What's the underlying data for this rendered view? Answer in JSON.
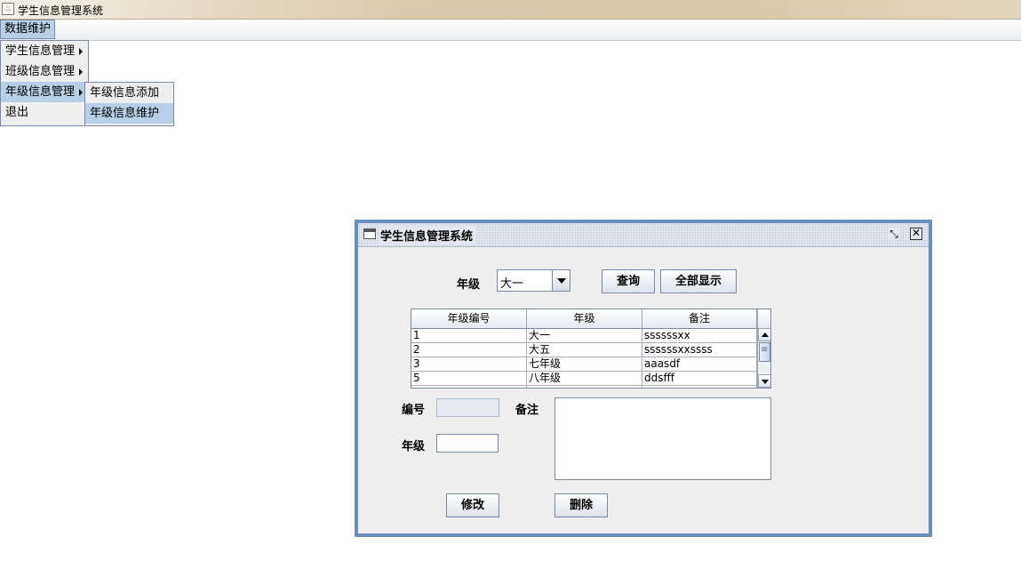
{
  "window": {
    "title": "学生信息管理系统"
  },
  "menubar": {
    "data_menu": "数据维护"
  },
  "popup_main": {
    "items": [
      {
        "label": "学生信息管理"
      },
      {
        "label": "班级信息管理"
      },
      {
        "label": "年级信息管理"
      },
      {
        "label": "退出"
      }
    ]
  },
  "popup_sub": {
    "items": [
      {
        "label": "年级信息添加"
      },
      {
        "label": "年级信息维护"
      }
    ]
  },
  "frame": {
    "title": "学生信息管理系统",
    "restore_icon": "restore-icon",
    "close_icon": "close-icon"
  },
  "search": {
    "grade_label": "年级",
    "grade_selected": "大一",
    "query_button": "查询",
    "show_all_button": "全部显示"
  },
  "table": {
    "headers": [
      "年级编号",
      "年级",
      "备注"
    ],
    "rows": [
      [
        "1",
        "大一",
        "ssssssxx"
      ],
      [
        "2",
        "大五",
        "ssssssxxssss"
      ],
      [
        "3",
        "七年级",
        "aaasdf"
      ],
      [
        "5",
        "八年级",
        "ddsfff"
      ]
    ]
  },
  "form": {
    "id_label": "编号",
    "id_value": "",
    "grade_label": "年级",
    "grade_value": "",
    "remark_label": "备注",
    "remark_value": "",
    "modify_button": "修改",
    "delete_button": "删除"
  }
}
